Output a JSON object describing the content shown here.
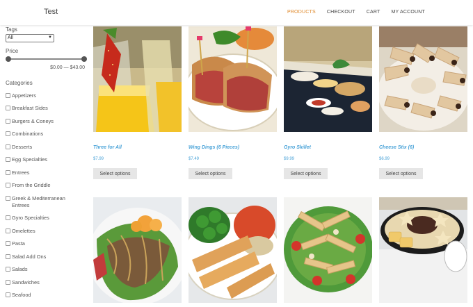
{
  "header": {
    "site_title": "Test",
    "nav": [
      "PRODUCTS",
      "CHECKOUT",
      "CART",
      "MY ACCOUNT"
    ],
    "active_nav": "PRODUCTS",
    "accent_color": "#e08a2c"
  },
  "sidebar": {
    "tags_label": "Tags",
    "tags_selected": "All",
    "price_label": "Price",
    "price_range": "$0.00 — $43.00",
    "price_min": 0,
    "price_max": 43,
    "categories_label": "Categories",
    "categories": [
      "Appetizers",
      "Breakfast Sides",
      "Burgers & Coneys",
      "Combinations",
      "Desserts",
      "Egg Specialties",
      "Entrees",
      "From the Griddle",
      "Greek & Mediterranean Entrees",
      "Gyro Specialties",
      "Omelettes",
      "Pasta",
      "Salad Add Ons",
      "Salads",
      "Sandwiches",
      "Seafood"
    ]
  },
  "products": [
    {
      "title": "Three for All",
      "price": "$7.99",
      "button": "Select options"
    },
    {
      "title": "Wing Dings (6 Pieces)",
      "price": "$7.49",
      "button": "Select options"
    },
    {
      "title": "Gyro Skillet",
      "price": "$9.99",
      "button": "Select options"
    },
    {
      "title": "Cheese Stix (6)",
      "price": "$6.99",
      "button": "Select options"
    }
  ],
  "link_color": "#4aa3d8"
}
